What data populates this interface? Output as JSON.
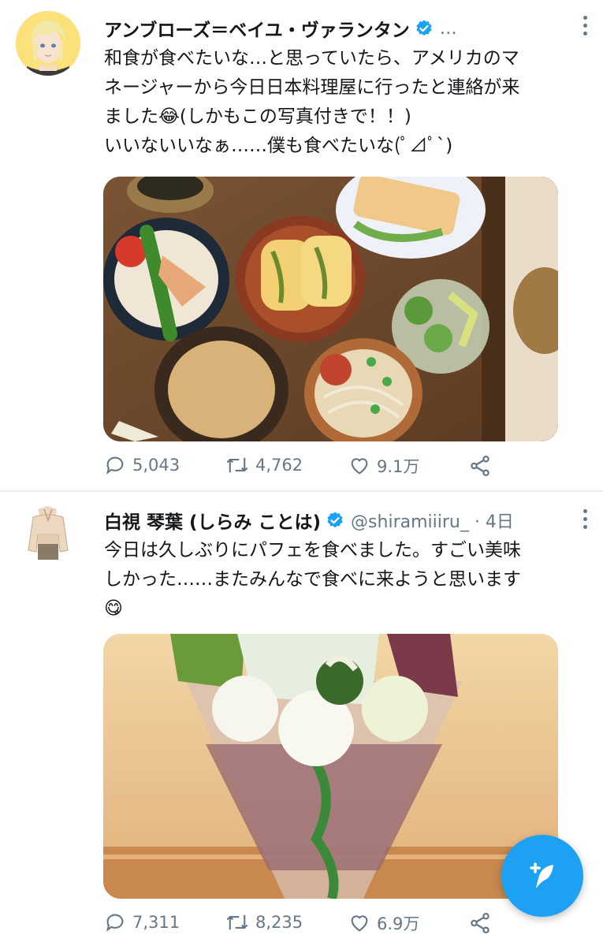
{
  "tweets": [
    {
      "author_name": "アンブローズ＝ベイユ・ヴァランタン",
      "handle": "…",
      "text_lines": [
        "和食が食べたいな…と思っていたら、アメリカのマ",
        "ネージャーから今日日本料理屋に行ったと連絡が来",
        "ました😂(しかもこの写真付きで！！)",
        "いいないいなぁ……僕も食べたいな(ﾟ⊿ﾟ`)"
      ],
      "replies": "5,043",
      "retweets": "4,762",
      "likes": "9.1万",
      "avatar_icon": "blonde-character-avatar",
      "media_icon": "japanese-set-meal-photo"
    },
    {
      "author_name": "白視 琴葉 (しらみ ことは)",
      "handle": "@shiramiiiru_ · 4日",
      "text_lines": [
        "今日は久しぶりにパフェを食べました。すごい美味",
        "しかった……またみんなで食べに来ようと思います",
        "😋"
      ],
      "replies": "7,311",
      "retweets": "8,235",
      "likes": "6.9万",
      "avatar_icon": "sweater-figure-avatar",
      "media_icon": "matcha-parfait-photo"
    }
  ],
  "colors": {
    "accent": "#1da1f2",
    "text_primary": "#14171a",
    "text_secondary": "#657786",
    "divider": "#e6ecf0"
  },
  "fab_icon": "compose-feather-icon"
}
